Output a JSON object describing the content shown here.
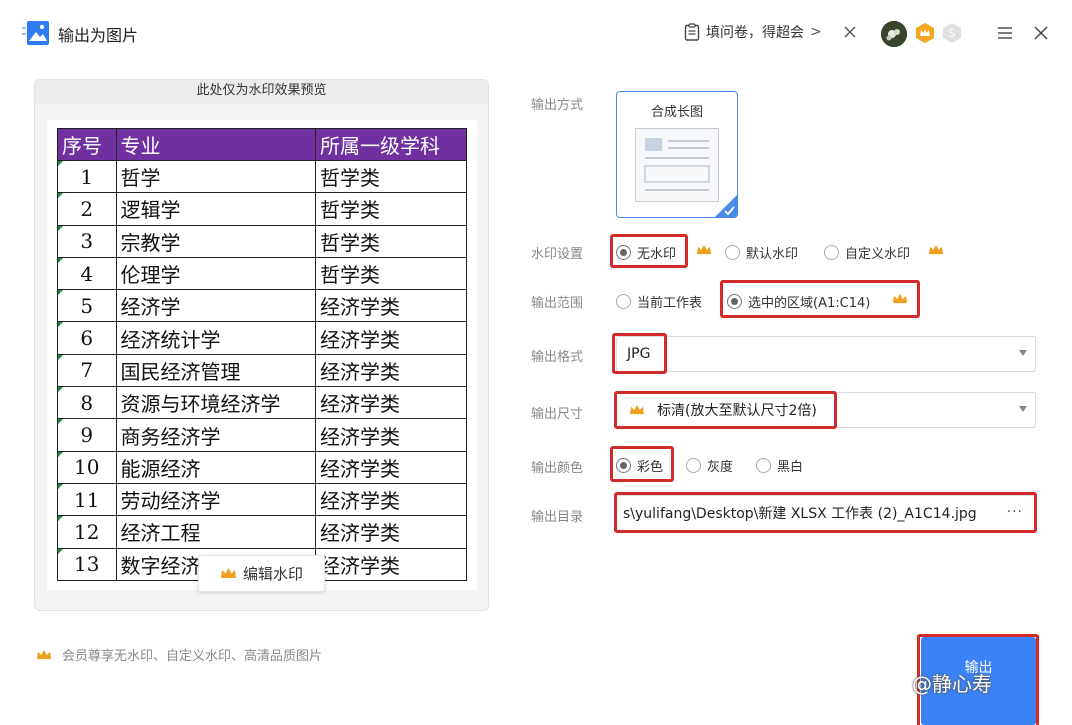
{
  "window": {
    "title": "输出为图片",
    "survey_text": "填问卷，得超会"
  },
  "preview": {
    "header": "此处仅为水印效果预览",
    "table": {
      "headers": [
        "序号",
        "专业",
        "所属一级学科"
      ],
      "rows": [
        [
          "1",
          "哲学",
          "哲学类"
        ],
        [
          "2",
          "逻辑学",
          "哲学类"
        ],
        [
          "3",
          "宗教学",
          "哲学类"
        ],
        [
          "4",
          "伦理学",
          "哲学类"
        ],
        [
          "5",
          "经济学",
          "经济学类"
        ],
        [
          "6",
          "经济统计学",
          "经济学类"
        ],
        [
          "7",
          "国民经济管理",
          "经济学类"
        ],
        [
          "8",
          "资源与环境经济学",
          "经济学类"
        ],
        [
          "9",
          "商务经济学",
          "经济学类"
        ],
        [
          "10",
          "能源经济",
          "经济学类"
        ],
        [
          "11",
          "劳动经济学",
          "经济学类"
        ],
        [
          "12",
          "经济工程",
          "经济学类"
        ],
        [
          "13",
          "数字经济",
          "经济学类"
        ]
      ]
    },
    "edit_watermark_label": "编辑水印"
  },
  "settings": {
    "output_mode": {
      "label": "输出方式",
      "card_title": "合成长图"
    },
    "watermark": {
      "label": "水印设置",
      "options": [
        "无水印",
        "默认水印",
        "自定义水印"
      ],
      "selected": "无水印"
    },
    "range": {
      "label": "输出范围",
      "options": [
        "当前工作表",
        "选中的区域(A1:C14)"
      ],
      "selected": "选中的区域(A1:C14)"
    },
    "format": {
      "label": "输出格式",
      "value": "JPG"
    },
    "size": {
      "label": "输出尺寸",
      "value": "标清(放大至默认尺寸2倍)"
    },
    "color": {
      "label": "输出颜色",
      "options": [
        "彩色",
        "灰度",
        "黑白"
      ],
      "selected": "彩色"
    },
    "directory": {
      "label": "输出目录",
      "value": "s\\yulifang\\Desktop\\新建 XLSX 工作表 (2)_A1C14.jpg",
      "more": "···"
    }
  },
  "footer": {
    "note": "会员尊享无水印、自定义水印、高清品质图片",
    "export_label": "输出",
    "watermark_overlay": "@静心寿"
  },
  "colors": {
    "accent": "#3b82f6",
    "highlight": "#d42a2a",
    "header_purple": "#7030a0",
    "crown": "#f0a020"
  }
}
